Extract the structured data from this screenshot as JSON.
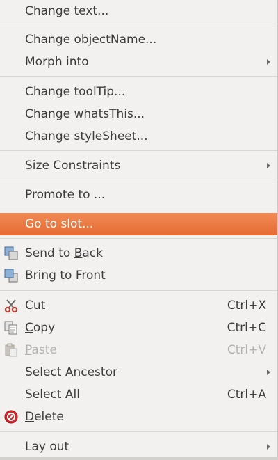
{
  "menu": {
    "items": [
      {
        "label": "Change text..."
      },
      {
        "label": "Change objectName..."
      },
      {
        "label": "Morph into"
      },
      {
        "label": "Change toolTip..."
      },
      {
        "label": "Change whatsThis..."
      },
      {
        "label": "Change styleSheet..."
      },
      {
        "label": "Size Constraints"
      },
      {
        "label": "Promote to ..."
      },
      {
        "label": "Go to slot..."
      },
      {
        "pre": "Send to ",
        "u": "B",
        "post": "ack",
        "icon": "send-to-back-icon"
      },
      {
        "pre": "Bring to ",
        "u": "F",
        "post": "ront",
        "icon": "bring-to-front-icon"
      },
      {
        "pre": "Cu",
        "u": "t",
        "post": "",
        "shortcut": "Ctrl+X",
        "icon": "scissors-icon"
      },
      {
        "pre": "",
        "u": "C",
        "post": "opy",
        "shortcut": "Ctrl+C",
        "icon": "copy-icon"
      },
      {
        "pre": "",
        "u": "P",
        "post": "aste",
        "shortcut": "Ctrl+V",
        "icon": "paste-icon",
        "disabled": true
      },
      {
        "label": "Select Ancestor"
      },
      {
        "pre": "Select ",
        "u": "A",
        "post": "ll",
        "shortcut": "Ctrl+A"
      },
      {
        "pre": "",
        "u": "D",
        "post": "elete",
        "icon": "delete-icon"
      },
      {
        "label": "Lay out"
      }
    ]
  }
}
